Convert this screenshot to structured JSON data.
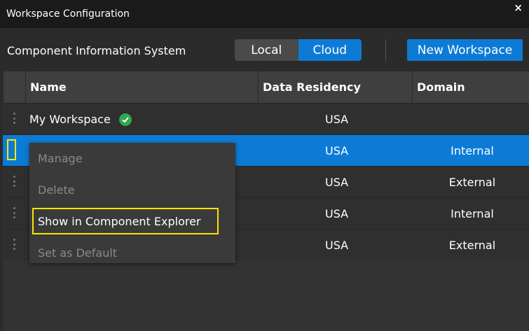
{
  "window": {
    "title": "Workspace Configuration",
    "close_label": "×"
  },
  "toolbar": {
    "label": "Component Information System",
    "local_label": "Local",
    "cloud_label": "Cloud",
    "new_workspace_label": "New Workspace"
  },
  "columns": {
    "name": "Name",
    "residency": "Data Residency",
    "domain": "Domain"
  },
  "rows": [
    {
      "name": "My Workspace",
      "residency": "USA",
      "domain": "",
      "default": true
    },
    {
      "name": "",
      "residency": "USA",
      "domain": "Internal",
      "selected": true
    },
    {
      "name": "",
      "residency": "USA",
      "domain": "External"
    },
    {
      "name": "",
      "residency": "USA",
      "domain": "Internal"
    },
    {
      "name": "",
      "residency": "USA",
      "domain": "External"
    }
  ],
  "context_menu": {
    "items": [
      {
        "label": "Manage",
        "enabled": false
      },
      {
        "label": "Delete",
        "enabled": false
      },
      {
        "label": "Show in Component Explorer",
        "enabled": true
      },
      {
        "label": "Set as Default",
        "enabled": false
      }
    ]
  },
  "colors": {
    "accent": "#0d7bd6",
    "highlight": "#ffe500",
    "check": "#2fa84f"
  }
}
